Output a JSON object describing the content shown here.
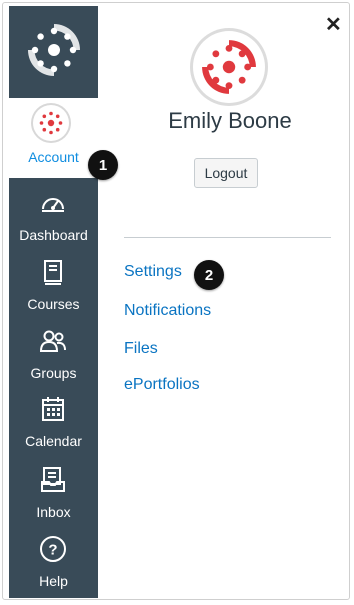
{
  "nav": {
    "account_label": "Account",
    "items": [
      {
        "label": "Dashboard",
        "icon": "dashboard-icon"
      },
      {
        "label": "Courses",
        "icon": "courses-icon"
      },
      {
        "label": "Groups",
        "icon": "groups-icon"
      },
      {
        "label": "Calendar",
        "icon": "calendar-icon"
      },
      {
        "label": "Inbox",
        "icon": "inbox-icon"
      },
      {
        "label": "Help",
        "icon": "help-icon"
      }
    ]
  },
  "tray": {
    "user_name": "Emily Boone",
    "logout_label": "Logout",
    "links": [
      "Settings",
      "Notifications",
      "Files",
      "ePortfolios"
    ]
  },
  "callouts": {
    "account": "1",
    "settings": "2"
  },
  "colors": {
    "nav_bg": "#394b58",
    "accent": "#0f8de0",
    "link": "#0a74c2",
    "logo_red": "#e0393e"
  }
}
